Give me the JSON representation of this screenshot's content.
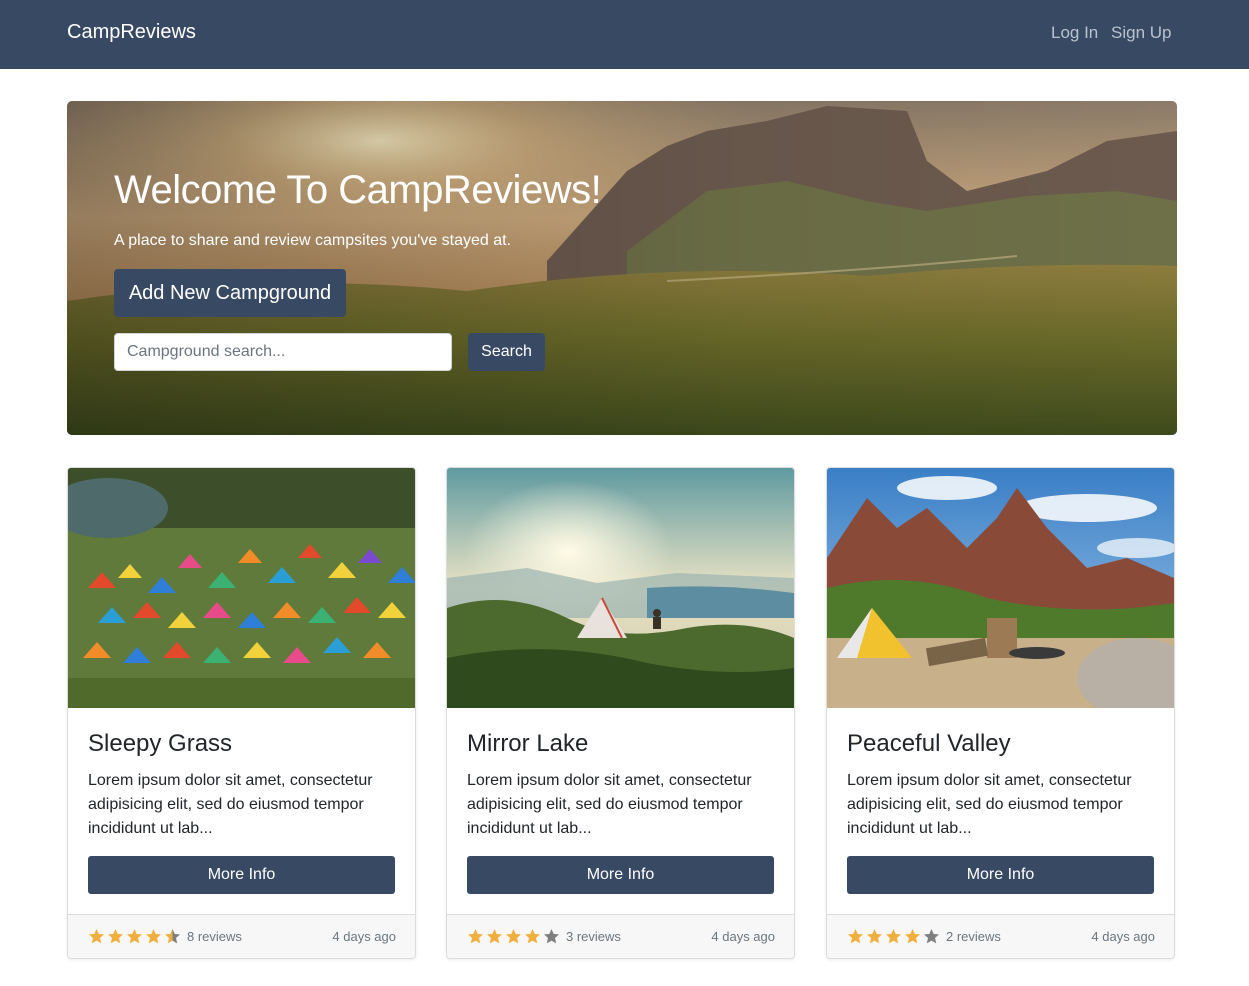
{
  "navbar": {
    "brand": "CampReviews",
    "login_label": "Log In",
    "signup_label": "Sign Up"
  },
  "hero": {
    "title": "Welcome To CampReviews!",
    "subtitle": "A place to share and review campsites you've stayed at.",
    "add_button_label": "Add New Campground",
    "search_placeholder": "Campground search...",
    "search_value": "",
    "search_button_label": "Search"
  },
  "colors": {
    "primary": "#384a63",
    "star_filled": "#f0b03f",
    "star_empty": "#7f7f7f"
  },
  "cards": [
    {
      "title": "Sleepy Grass",
      "description": "Lorem ipsum dolor sit amet, consectetur adipisicing elit, sed do eiusmod tempor incididunt ut lab...",
      "button_label": "More Info",
      "rating": 4.5,
      "reviews_label": "8 reviews",
      "date": "4 days ago"
    },
    {
      "title": "Mirror Lake",
      "description": "Lorem ipsum dolor sit amet, consectetur adipisicing elit, sed do eiusmod tempor incididunt ut lab...",
      "button_label": "More Info",
      "rating": 4,
      "reviews_label": "3 reviews",
      "date": "4 days ago"
    },
    {
      "title": "Peaceful Valley",
      "description": "Lorem ipsum dolor sit amet, consectetur adipisicing elit, sed do eiusmod tempor incididunt ut lab...",
      "button_label": "More Info",
      "rating": 4,
      "reviews_label": "2 reviews",
      "date": "4 days ago"
    }
  ]
}
